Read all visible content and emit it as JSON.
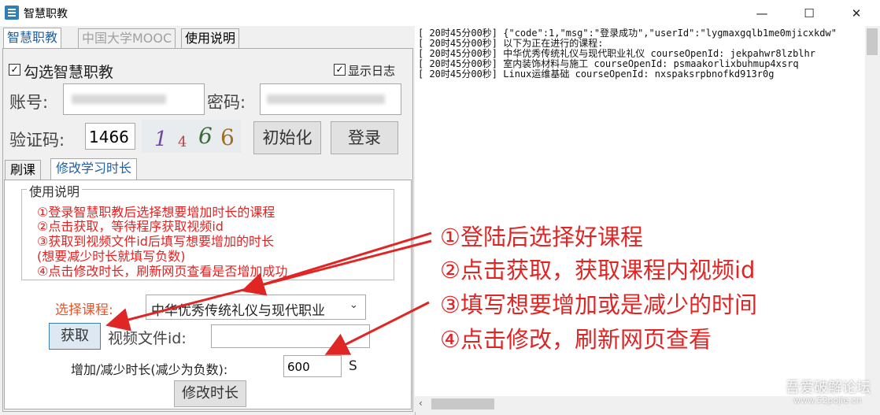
{
  "window": {
    "title": "智慧职教",
    "minimize": "—",
    "maximize": "☐",
    "close": "✕"
  },
  "tabs": [
    "智慧职教",
    "中国大学MOOC",
    "使用说明"
  ],
  "login": {
    "checkbox_label": "勾选智慧职教",
    "show_log_label": "显示日志",
    "account_label": "账号:",
    "password_label": "密码:",
    "captcha_label": "验证码:",
    "captcha_value": "1466",
    "captcha_image_chars": [
      "1",
      "4",
      "6",
      "6"
    ],
    "init_button": "初始化",
    "login_button": "登录"
  },
  "subtabs": [
    "刷课",
    "修改学习时长"
  ],
  "instructions": {
    "legend": "使用说明",
    "lines": [
      "①登录智慧职教后选择想要增加时长的课程",
      "②点击获取，等待程序获取视频id",
      "③获取到视频文件id后填写想要增加的时长",
      "(想要减少时长就填写负数)",
      "④点击修改时长，刷新网页查看是否增加成功"
    ]
  },
  "course_select": {
    "label": "选择课程:",
    "value": "中华优秀传统礼仪与现代职业"
  },
  "fetch_button": "获取",
  "video_id_label": "视频文件id:",
  "duration_label": "增加/减少时长(减少为负数):",
  "duration_value": "600",
  "duration_unit": "S",
  "modify_button": "修改时长",
  "log_lines": [
    "[ 20时45分00秒] {\"code\":1,\"msg\":\"登录成功\",\"userId\":\"lygmaxgqlb1me0mjicxkdw\"",
    "[ 20时45分00秒] 以下为正在进行的课程:",
    "[ 20时45分00秒] 中华优秀传统礼仪与现代职业礼仪 courseOpenId: jekpahwr8lzblhr",
    "[ 20时45分00秒] 室内装饰材料与施工 courseOpenId: psmaakorlixbuhmup4xsrq",
    "[ 20时45分00秒] Linux运维基础 courseOpenId: nxspaksrpbnofkd913r0g"
  ],
  "annotations": [
    "①登陆后选择好课程",
    "②点击获取，获取课程内视频id",
    "③填写想要增加或是减少的时间",
    "④点击修改，刷新网页查看"
  ],
  "watermark": "吾爱破解论坛",
  "watermark_url": "www.52pojie.cn",
  "colors": {
    "annotation_red": "#e02525",
    "instruction_red": "#e82020",
    "tab_blue": "#1f5fa8"
  }
}
